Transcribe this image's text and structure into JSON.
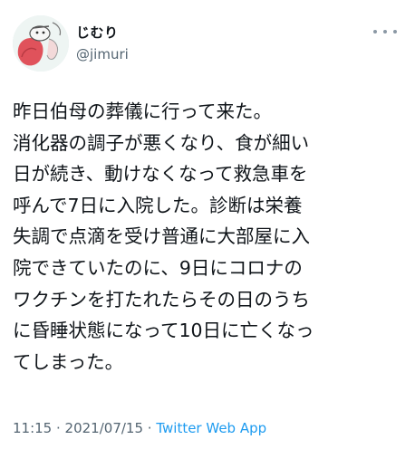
{
  "user": {
    "display_name": "じむり",
    "handle": "@jimuri",
    "avatar_icon": "avatar-illustration-icon"
  },
  "tweet": {
    "lines": [
      "昨日伯母の葬儀に行って来た。",
      "消化器の調子が悪くなり、食が細い",
      "日が続き、動けなくなって救急車を",
      "呼んで7日に入院した。診断は栄養",
      "失調で点滴を受け普通に大部屋に入",
      "院できていたのに、9日にコロナの",
      "ワクチンを打たれたらその日のうち",
      "に昏睡状態になって10日に亡くなっ",
      "てしまった。"
    ],
    "time": "11:15",
    "separator": " · ",
    "date": "2021/07/15",
    "source": "Twitter Web App"
  },
  "colors": {
    "text": "#0f1419",
    "secondary": "#536471",
    "link": "#1d9bf0"
  },
  "icons": {
    "more": "more-options-icon"
  }
}
